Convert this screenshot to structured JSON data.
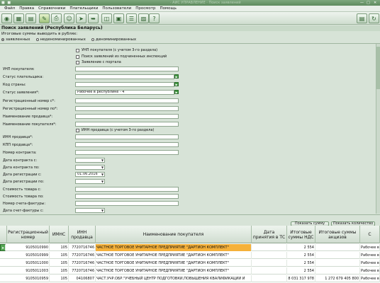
{
  "titlebar": {
    "title": "· АИС УПРАВЛЕНИЕ · Поиск заявлений"
  },
  "menu": {
    "file": "Файл",
    "edit": "Правка",
    "refs": "Справочники",
    "payers": "Плательщики",
    "users": "Пользователи",
    "view": "Просмотр",
    "help": "Помощь"
  },
  "form": {
    "title": "Поиск заявлений (Республика Беларусь)",
    "subtitle": "Итоговые суммы выводить в рублях:",
    "radio1": "заявленных",
    "radio2": "неденоминированных",
    "radio3": "деноминированных",
    "chk_unp": "УНП покупателя (с учетом 3-го раздела)",
    "chk_sub": "Поиск заявлений из подчиненных инспекций",
    "chk_portal": "Заявление с портала",
    "chk_inn": "ИНН продавца (с учетом 3-го раздела)",
    "l_unp": "УНП покупателя:",
    "l_status_pay": "Статус плательщика:",
    "l_country": "Код страны:",
    "l_status": "Статус заявления*:",
    "v_status": "Рабочее в республике - 4",
    "l_reg_from": "Регистрационный номер с*:",
    "l_reg_to": "Регистрационный номер по*:",
    "l_seller": "Наименование продавца*:",
    "l_buyer": "Наименование покупателя*:",
    "l_inn": "ИНН продавца*:",
    "l_kpp": "КПП продавца*:",
    "l_contract": "Номер контракта:",
    "l_cdate_from": "Дата контракта с:",
    "l_cdate_to": "Дата контракта по:",
    "l_rdate_from": "Дата регистрации с:",
    "v_rdate_from": "01.06.2016",
    "l_rdate_to": "Дата регистрации по:",
    "l_cost_from": "Стоимость товара с:",
    "l_cost_to": "Стоимость товара по:",
    "l_invoice": "Номер счета-фактуры:",
    "l_idate_from": "Дата счет-фактуры с:"
  },
  "actions": {
    "show_sum": "Показать сумму",
    "show_count": "Показать количество"
  },
  "grid": {
    "headers": {
      "regnum": "Регистрационный номер",
      "imns": "ИМНС",
      "inn": "ИНН продавца",
      "name": "Наименование покупателя",
      "date": "Дата принятия в ТС",
      "nds": "Итоговые суммы НДС",
      "akciz": "Итоговые суммы акцизов",
      "status": "С"
    },
    "rows": [
      {
        "regnum": "9105010990",
        "imns": "105",
        "inn": "7720716746",
        "name": "ЧАСТНОЕ ТОРГОВОЕ УНИТАРНОЕ ПРЕДПРИЯТИЕ \"ДАРТИОН КОМПЛЕКТ\"",
        "date": "",
        "nds": "2 554",
        "akciz": "",
        "status": "Рабочее в"
      },
      {
        "regnum": "9105010999",
        "imns": "105",
        "inn": "7720716746",
        "name": "ЧАСТНОЕ ТОРГОВОЕ УНИТАРНОЕ ПРЕДПРИЯТИЕ \"ДАРТИОН КОМПЛЕКТ\"",
        "date": "",
        "nds": "2 554",
        "akciz": "",
        "status": "Рабочее в"
      },
      {
        "regnum": "9105011000",
        "imns": "105",
        "inn": "7720716746",
        "name": "ЧАСТНОЕ ТОРГОВОЕ УНИТАРНОЕ ПРЕДПРИЯТИЕ \"ДАРТИОН КОМПЛЕКТ\"",
        "date": "",
        "nds": "2 554",
        "akciz": "",
        "status": "Рабочее в"
      },
      {
        "regnum": "9105011003",
        "imns": "105",
        "inn": "7720716746",
        "name": "ЧАСТНОЕ ТОРГОВОЕ УНИТАРНОЕ ПРЕДПРИЯТИЕ \"ДАРТИОН КОМПЛЕКТ\"",
        "date": "",
        "nds": "2 554",
        "akciz": "",
        "status": "Рабочее в"
      },
      {
        "regnum": "9105010959",
        "imns": "105",
        "inn": "04106807",
        "name": "ЧАСТ.УЧР.ОБР.\"УЧЕБНЫЙ ЦЕНТР ПОДГОТОВКИ,ПОВЫШЕНИЯ КВАЛИФИКАЦИИ И",
        "date": "",
        "nds": "8 031 317 978",
        "akciz": "1 272 679 405 800",
        "status": "Рабочее в"
      }
    ]
  }
}
